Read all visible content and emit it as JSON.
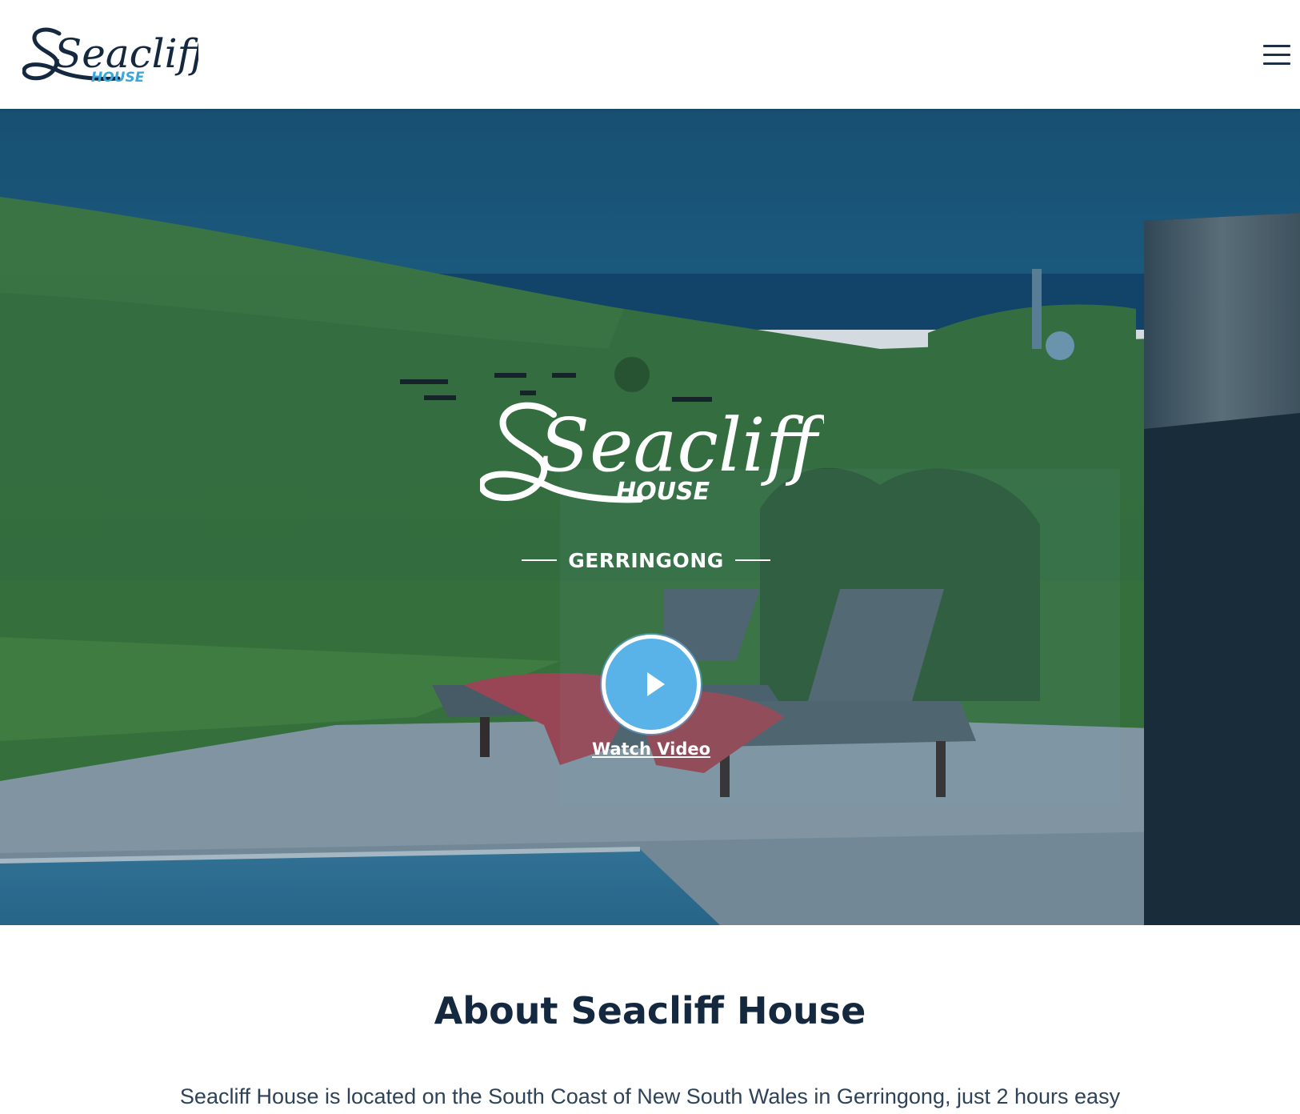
{
  "header": {
    "logo_script": "Seacliff",
    "logo_sub": "HOUSE",
    "menu_icon": "hamburger-menu-icon"
  },
  "hero": {
    "logo_script": "Seacliff",
    "logo_sub": "HOUSE",
    "tagline": "GERRINGONG",
    "play_icon": "play-icon",
    "watch_label": "Watch Video"
  },
  "about": {
    "title": "About Seacliff House",
    "intro": "Seacliff House is located on the South Coast of New South Wales in Gerringong, just 2 hours easy"
  },
  "colors": {
    "navy": "#14283f",
    "accent_blue": "#39a7dc",
    "play_blue": "#5ab3e8"
  }
}
